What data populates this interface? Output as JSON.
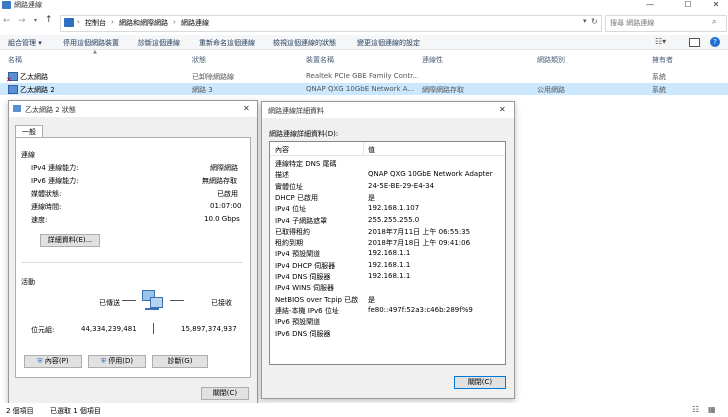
{
  "window": {
    "title": "網路連線",
    "minimize": "—",
    "maximize": "☐",
    "close": "✕"
  },
  "address": {
    "crumbs": [
      "控制台",
      "網路和網際網路",
      "網路連線"
    ],
    "sep": "›",
    "search_placeholder": "搜尋 網路連線"
  },
  "commands": [
    "組合管理 ▾",
    "停用這個網路裝置",
    "診斷這個連線",
    "重新命名這個連線",
    "檢視這個連線的狀態",
    "變更這個連線的設定"
  ],
  "columns": [
    "名稱",
    "狀態",
    "裝置名稱",
    "連線性",
    "網路類別",
    "擁有者"
  ],
  "rows": [
    {
      "name": "乙太網路",
      "status": "已卸除網路線",
      "device": "Realtek PCIe GBE Family Contr...",
      "conn": "",
      "category": "",
      "owner": "系統"
    },
    {
      "name": "乙太網路 2",
      "status": "網路 3",
      "device": "QNAP QXG 10GbE Network A...",
      "conn": "網際網路存取",
      "category": "公用網路",
      "owner": "系統"
    }
  ],
  "status_dialog": {
    "title": "乙太網路 2 狀態",
    "tab": "一般",
    "connection_group": "連線",
    "fields": [
      {
        "label": "IPv4 連線能力:",
        "value": "網際網路"
      },
      {
        "label": "IPv6 連線能力:",
        "value": "無網路存取"
      },
      {
        "label": "媒體狀態:",
        "value": "已啟用"
      },
      {
        "label": "連線時間:",
        "value": "01:07:00"
      },
      {
        "label": "速度:",
        "value": "10.0 Gbps"
      }
    ],
    "details_button": "詳細資料(E)...",
    "activity_group": "活動",
    "sent_label": "已傳送",
    "received_label": "已接收",
    "bytes_label": "位元組:",
    "bytes_sent": "44,334,239,481",
    "bytes_received": "15,897,374,937",
    "properties_button": "內容(P)",
    "disable_button": "停用(D)",
    "diagnose_button": "診斷(G)",
    "close_button": "關閉(C)"
  },
  "details_dialog": {
    "title": "網路連線詳細資料",
    "subtitle": "網路連線詳細資料(D):",
    "col_property": "內容",
    "col_value": "值",
    "rows": [
      {
        "k": "連線特定 DNS 尾碼",
        "v": ""
      },
      {
        "k": "描述",
        "v": "QNAP QXG 10GbE Network Adapter"
      },
      {
        "k": "實體位址",
        "v": "24-5E-BE-29-E4-34"
      },
      {
        "k": "DHCP 已啟用",
        "v": "是"
      },
      {
        "k": "IPv4 位址",
        "v": "192.168.1.107"
      },
      {
        "k": "IPv4 子網路遮罩",
        "v": "255.255.255.0"
      },
      {
        "k": "已取得租約",
        "v": "2018年7月11日 上午 06:55:35"
      },
      {
        "k": "租約到期",
        "v": "2018年7月18日 上午 09:41:06"
      },
      {
        "k": "IPv4 預設閘道",
        "v": "192.168.1.1"
      },
      {
        "k": "IPv4 DHCP 伺服器",
        "v": "192.168.1.1"
      },
      {
        "k": "IPv4 DNS 伺服器",
        "v": "192.168.1.1"
      },
      {
        "k": "IPv4 WINS 伺服器",
        "v": ""
      },
      {
        "k": "NetBIOS over Tcpip 已啟",
        "v": "是"
      },
      {
        "k": "連結-本機 IPv6 位址",
        "v": "fe80::497f:52a3:c46b:289f%9"
      },
      {
        "k": "IPv6 預設閘道",
        "v": ""
      },
      {
        "k": "IPv6 DNS 伺服器",
        "v": ""
      }
    ],
    "close_button": "關閉(C)"
  },
  "statusbar": {
    "items": "2 個項目",
    "selected": "已選取 1 個項目"
  },
  "colors": {
    "selected_row": "#cce8ff",
    "accent": "#0078d7"
  }
}
